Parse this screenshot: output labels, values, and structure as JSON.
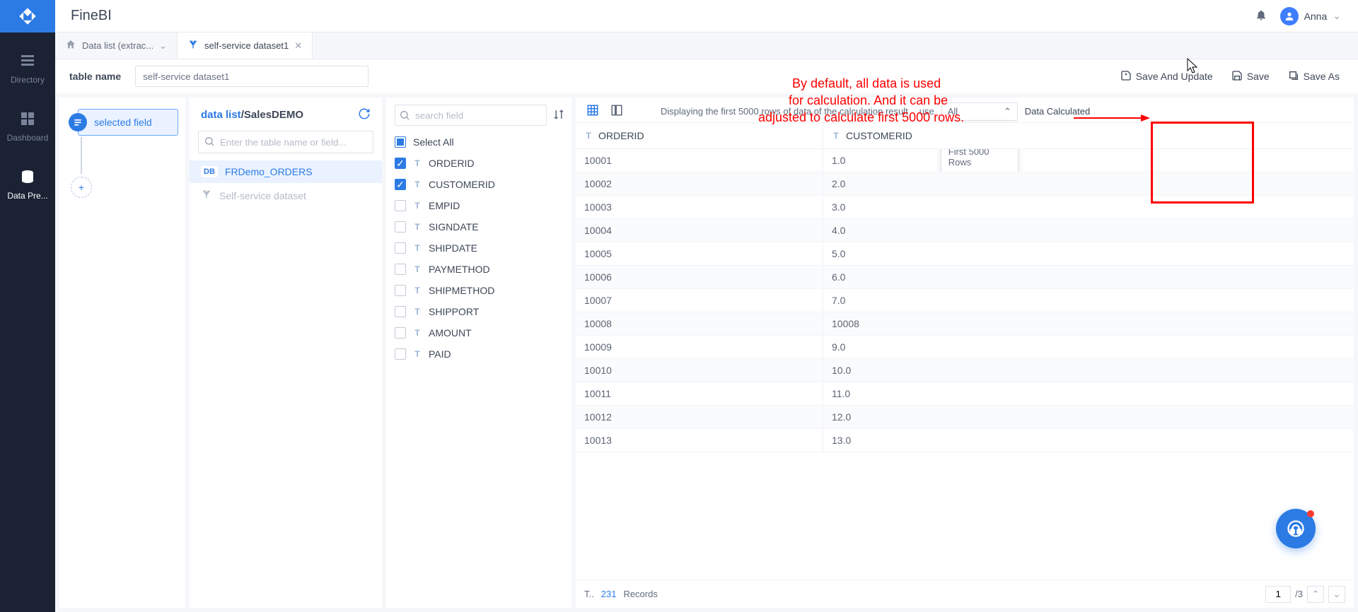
{
  "brand": "FineBI",
  "user": {
    "name": "Anna"
  },
  "nav": {
    "directory": "Directory",
    "dashboard": "Dashboard",
    "dataprep": "Data Pre..."
  },
  "tabs": {
    "first": "Data list (extrac...",
    "second": "self-service dataset1"
  },
  "tableName": {
    "label": "table name",
    "value": "self-service dataset1"
  },
  "actions": {
    "saveUpdate": "Save And Update",
    "save": "Save",
    "saveAs": "Save As"
  },
  "steps": {
    "selectedField": "selected field"
  },
  "source": {
    "titlePrefix": "data list",
    "titleSuffix": "/SalesDEMO",
    "searchPlaceholder": "Enter the table name or field...",
    "items": {
      "t1": "FRDemo_ORDERS",
      "t2": "Self-service dataset"
    }
  },
  "fields": {
    "searchPlaceholder": "search field",
    "selectAll": "Select All",
    "list": {
      "f0": "ORDERID",
      "f1": "CUSTOMERID",
      "f2": "EMPID",
      "f3": "SIGNDATE",
      "f4": "SHIPDATE",
      "f5": "PAYMETHOD",
      "f6": "SHIPMETHOD",
      "f7": "SHIPPORT",
      "f8": "AMOUNT",
      "f9": "PAID"
    }
  },
  "preview": {
    "infoText": "Displaying the first 5000 rows of data of the calculation result",
    "useLabel": "use",
    "dropdownValue": "All",
    "dropdownOptions": {
      "o1": "All",
      "o2": "First 5000 Rows"
    },
    "tailText": "Data Calculated",
    "columns": {
      "c1": "ORDERID",
      "c2": "CUSTOMERID"
    },
    "rows": [
      {
        "a": "10001",
        "b": "1.0"
      },
      {
        "a": "10002",
        "b": "2.0"
      },
      {
        "a": "10003",
        "b": "3.0"
      },
      {
        "a": "10004",
        "b": "4.0"
      },
      {
        "a": "10005",
        "b": "5.0"
      },
      {
        "a": "10006",
        "b": "6.0"
      },
      {
        "a": "10007",
        "b": "7.0"
      },
      {
        "a": "10008",
        "b": "10008"
      },
      {
        "a": "10009",
        "b": "9.0"
      },
      {
        "a": "10010",
        "b": "10.0"
      },
      {
        "a": "10011",
        "b": "11.0"
      },
      {
        "a": "10012",
        "b": "12.0"
      },
      {
        "a": "10013",
        "b": "13.0"
      }
    ],
    "footer": {
      "t": "T..",
      "count": "231",
      "records": "Records",
      "page": "1",
      "totalPages": "/3"
    }
  },
  "annotation": {
    "line1": "By default, all data is used",
    "line2": "   for calculation. And it can be",
    "line3": "adjusted to calculate first 5000 rows."
  }
}
